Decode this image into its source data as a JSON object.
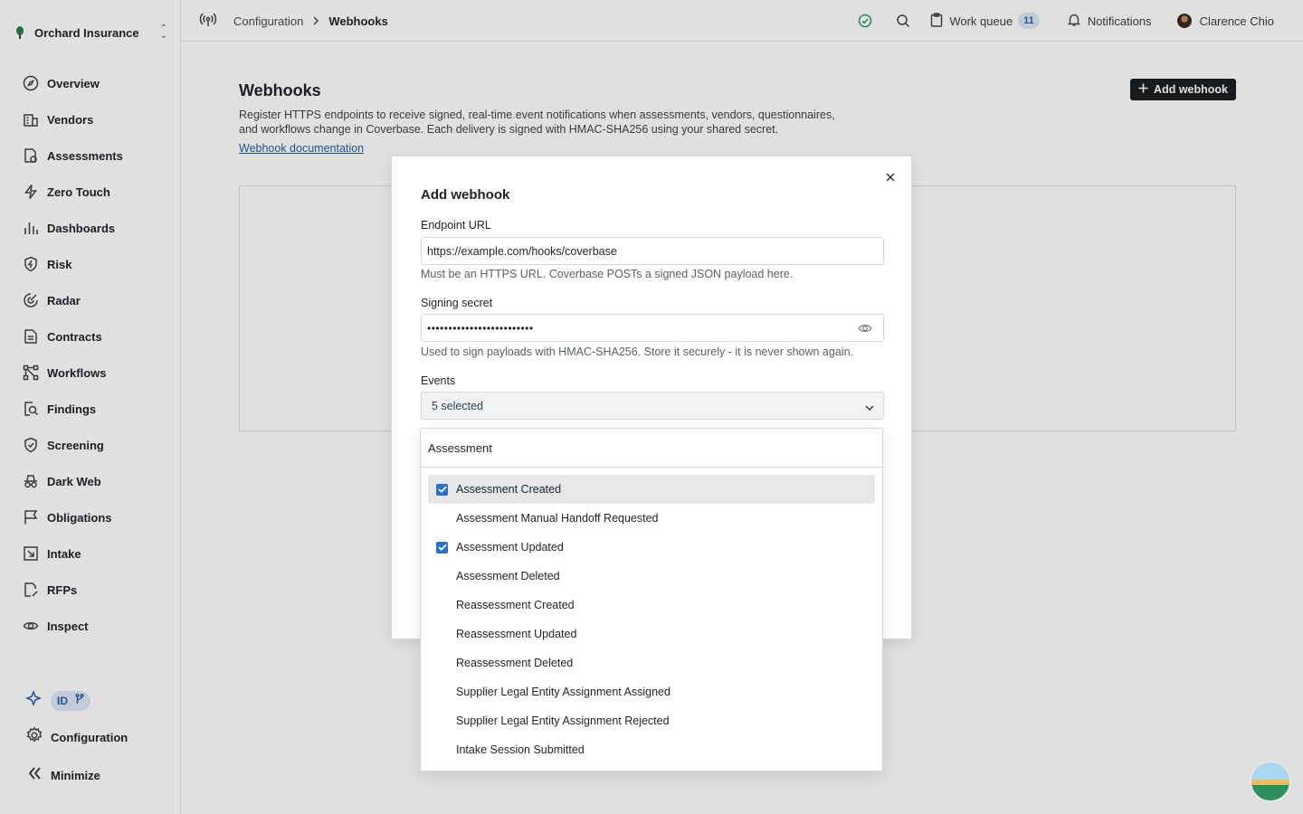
{
  "org": {
    "name": "Orchard Insurance"
  },
  "sidebar": {
    "items": [
      {
        "label": "Overview",
        "icon": "compass-icon"
      },
      {
        "label": "Vendors",
        "icon": "building-icon"
      },
      {
        "label": "Assessments",
        "icon": "document-check-icon"
      },
      {
        "label": "Zero Touch",
        "icon": "bolt-icon"
      },
      {
        "label": "Dashboards",
        "icon": "bar-chart-icon"
      },
      {
        "label": "Risk",
        "icon": "shield-bolt-icon"
      },
      {
        "label": "Radar",
        "icon": "radar-icon"
      },
      {
        "label": "Contracts",
        "icon": "contract-icon"
      },
      {
        "label": "Workflows",
        "icon": "workflow-icon"
      },
      {
        "label": "Findings",
        "icon": "magnifier-document-icon"
      },
      {
        "label": "Screening",
        "icon": "shield-check-icon"
      },
      {
        "label": "Dark Web",
        "icon": "spy-icon"
      },
      {
        "label": "Obligations",
        "icon": "flag-icon"
      },
      {
        "label": "Intake",
        "icon": "inbox-arrow-icon"
      },
      {
        "label": "RFPs",
        "icon": "document-edit-icon"
      },
      {
        "label": "Inspect",
        "icon": "eye-icon"
      }
    ],
    "badge_id": "ID",
    "configuration_label": "Configuration",
    "minimize_label": "Minimize"
  },
  "topbar": {
    "breadcrumb_parent": "Configuration",
    "breadcrumb_current": "Webhooks",
    "work_queue_label": "Work queue",
    "work_queue_count": "11",
    "notifications_label": "Notifications",
    "user_name": "Clarence Chio"
  },
  "page": {
    "title": "Webhooks",
    "description": "Register HTTPS endpoints to receive signed, real-time event notifications when assessments, vendors, questionnaires, and workflows change in Coverbase. Each delivery is signed with HMAC-SHA256 using your shared secret.",
    "doc_link": "Webhook documentation",
    "add_button": "Add webhook"
  },
  "modal": {
    "title": "Add webhook",
    "endpoint_label": "Endpoint URL",
    "endpoint_value": "https://example.com/hooks/coverbase",
    "endpoint_hint": "Must be an HTTPS URL. Coverbase POSTs a signed JSON payload here.",
    "secret_label": "Signing secret",
    "secret_value": "•••••••••••••••••••••••••",
    "secret_hint": "Used to sign payloads with HMAC-SHA256. Store it securely - it is never shown again.",
    "events_label": "Events",
    "events_selected": "5 selected"
  },
  "dropdown": {
    "search_value": "Assessment",
    "options": [
      {
        "label": "Assessment Created",
        "checked": true,
        "highlighted": true
      },
      {
        "label": "Assessment Manual Handoff Requested",
        "checked": false
      },
      {
        "label": "Assessment Updated",
        "checked": true
      },
      {
        "label": "Assessment Deleted",
        "checked": false
      },
      {
        "label": "Reassessment Created",
        "checked": false
      },
      {
        "label": "Reassessment Updated",
        "checked": false
      },
      {
        "label": "Reassessment Deleted",
        "checked": false
      },
      {
        "label": "Supplier Legal Entity Assignment Assigned",
        "checked": false
      },
      {
        "label": "Supplier Legal Entity Assignment Rejected",
        "checked": false
      },
      {
        "label": "Intake Session Submitted",
        "checked": false
      }
    ]
  },
  "colors": {
    "accent": "#2a6fc9",
    "primary_button": "#1b1f24",
    "status_ok": "#2e9a5b"
  }
}
